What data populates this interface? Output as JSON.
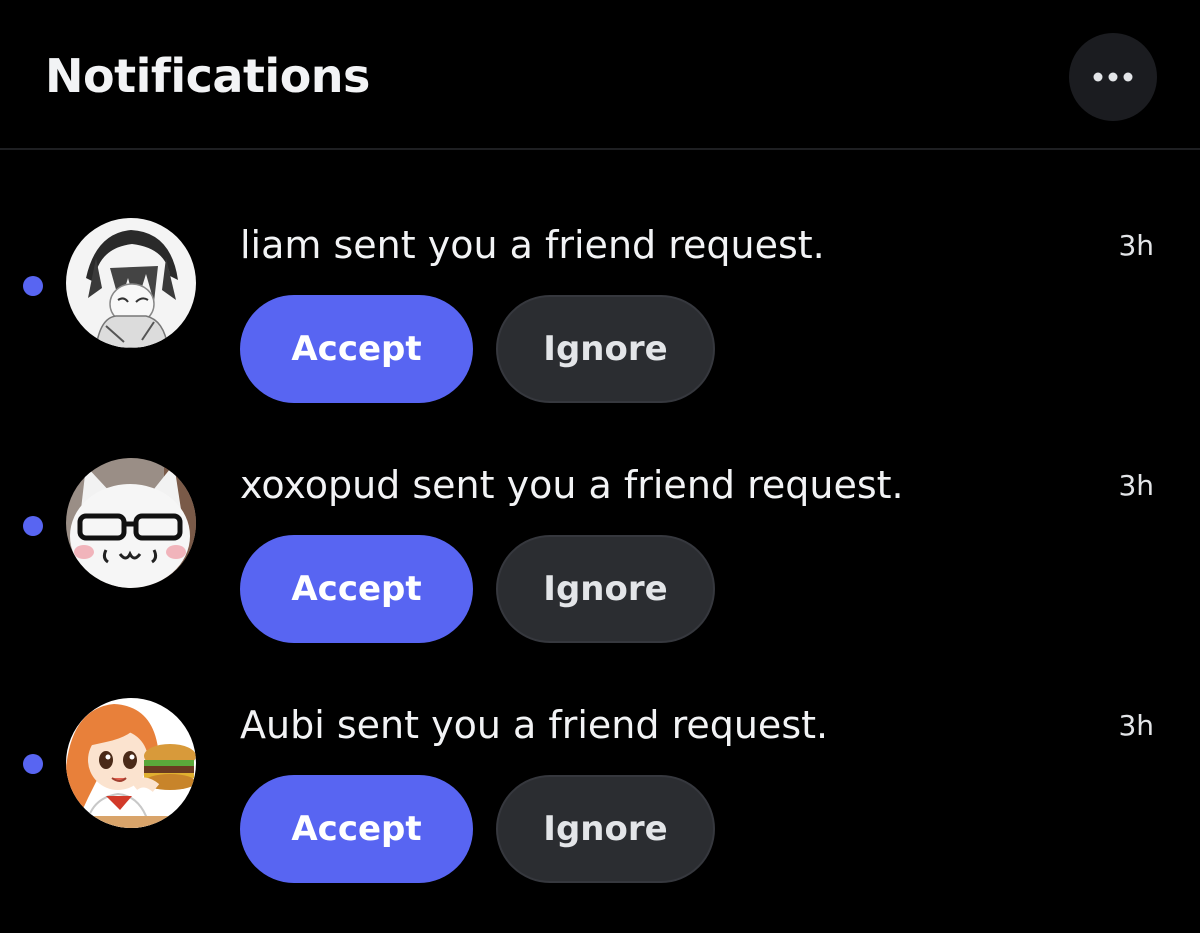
{
  "header": {
    "title": "Notifications",
    "more_icon": "more-horizontal-icon"
  },
  "notifications": [
    {
      "message": "liam sent you a friend request.",
      "time": "3h",
      "unread": true,
      "accept_label": "Accept",
      "ignore_label": "Ignore"
    },
    {
      "message": "xoxopud sent you a friend request.",
      "time": "3h",
      "unread": true,
      "accept_label": "Accept",
      "ignore_label": "Ignore"
    },
    {
      "message": "Aubi sent you a friend request.",
      "time": "3h",
      "unread": true,
      "accept_label": "Accept",
      "ignore_label": "Ignore"
    }
  ],
  "colors": {
    "background": "#000000",
    "accent": "#5865f2",
    "secondary_button": "#2b2d31",
    "unread_dot": "#5865f2"
  }
}
